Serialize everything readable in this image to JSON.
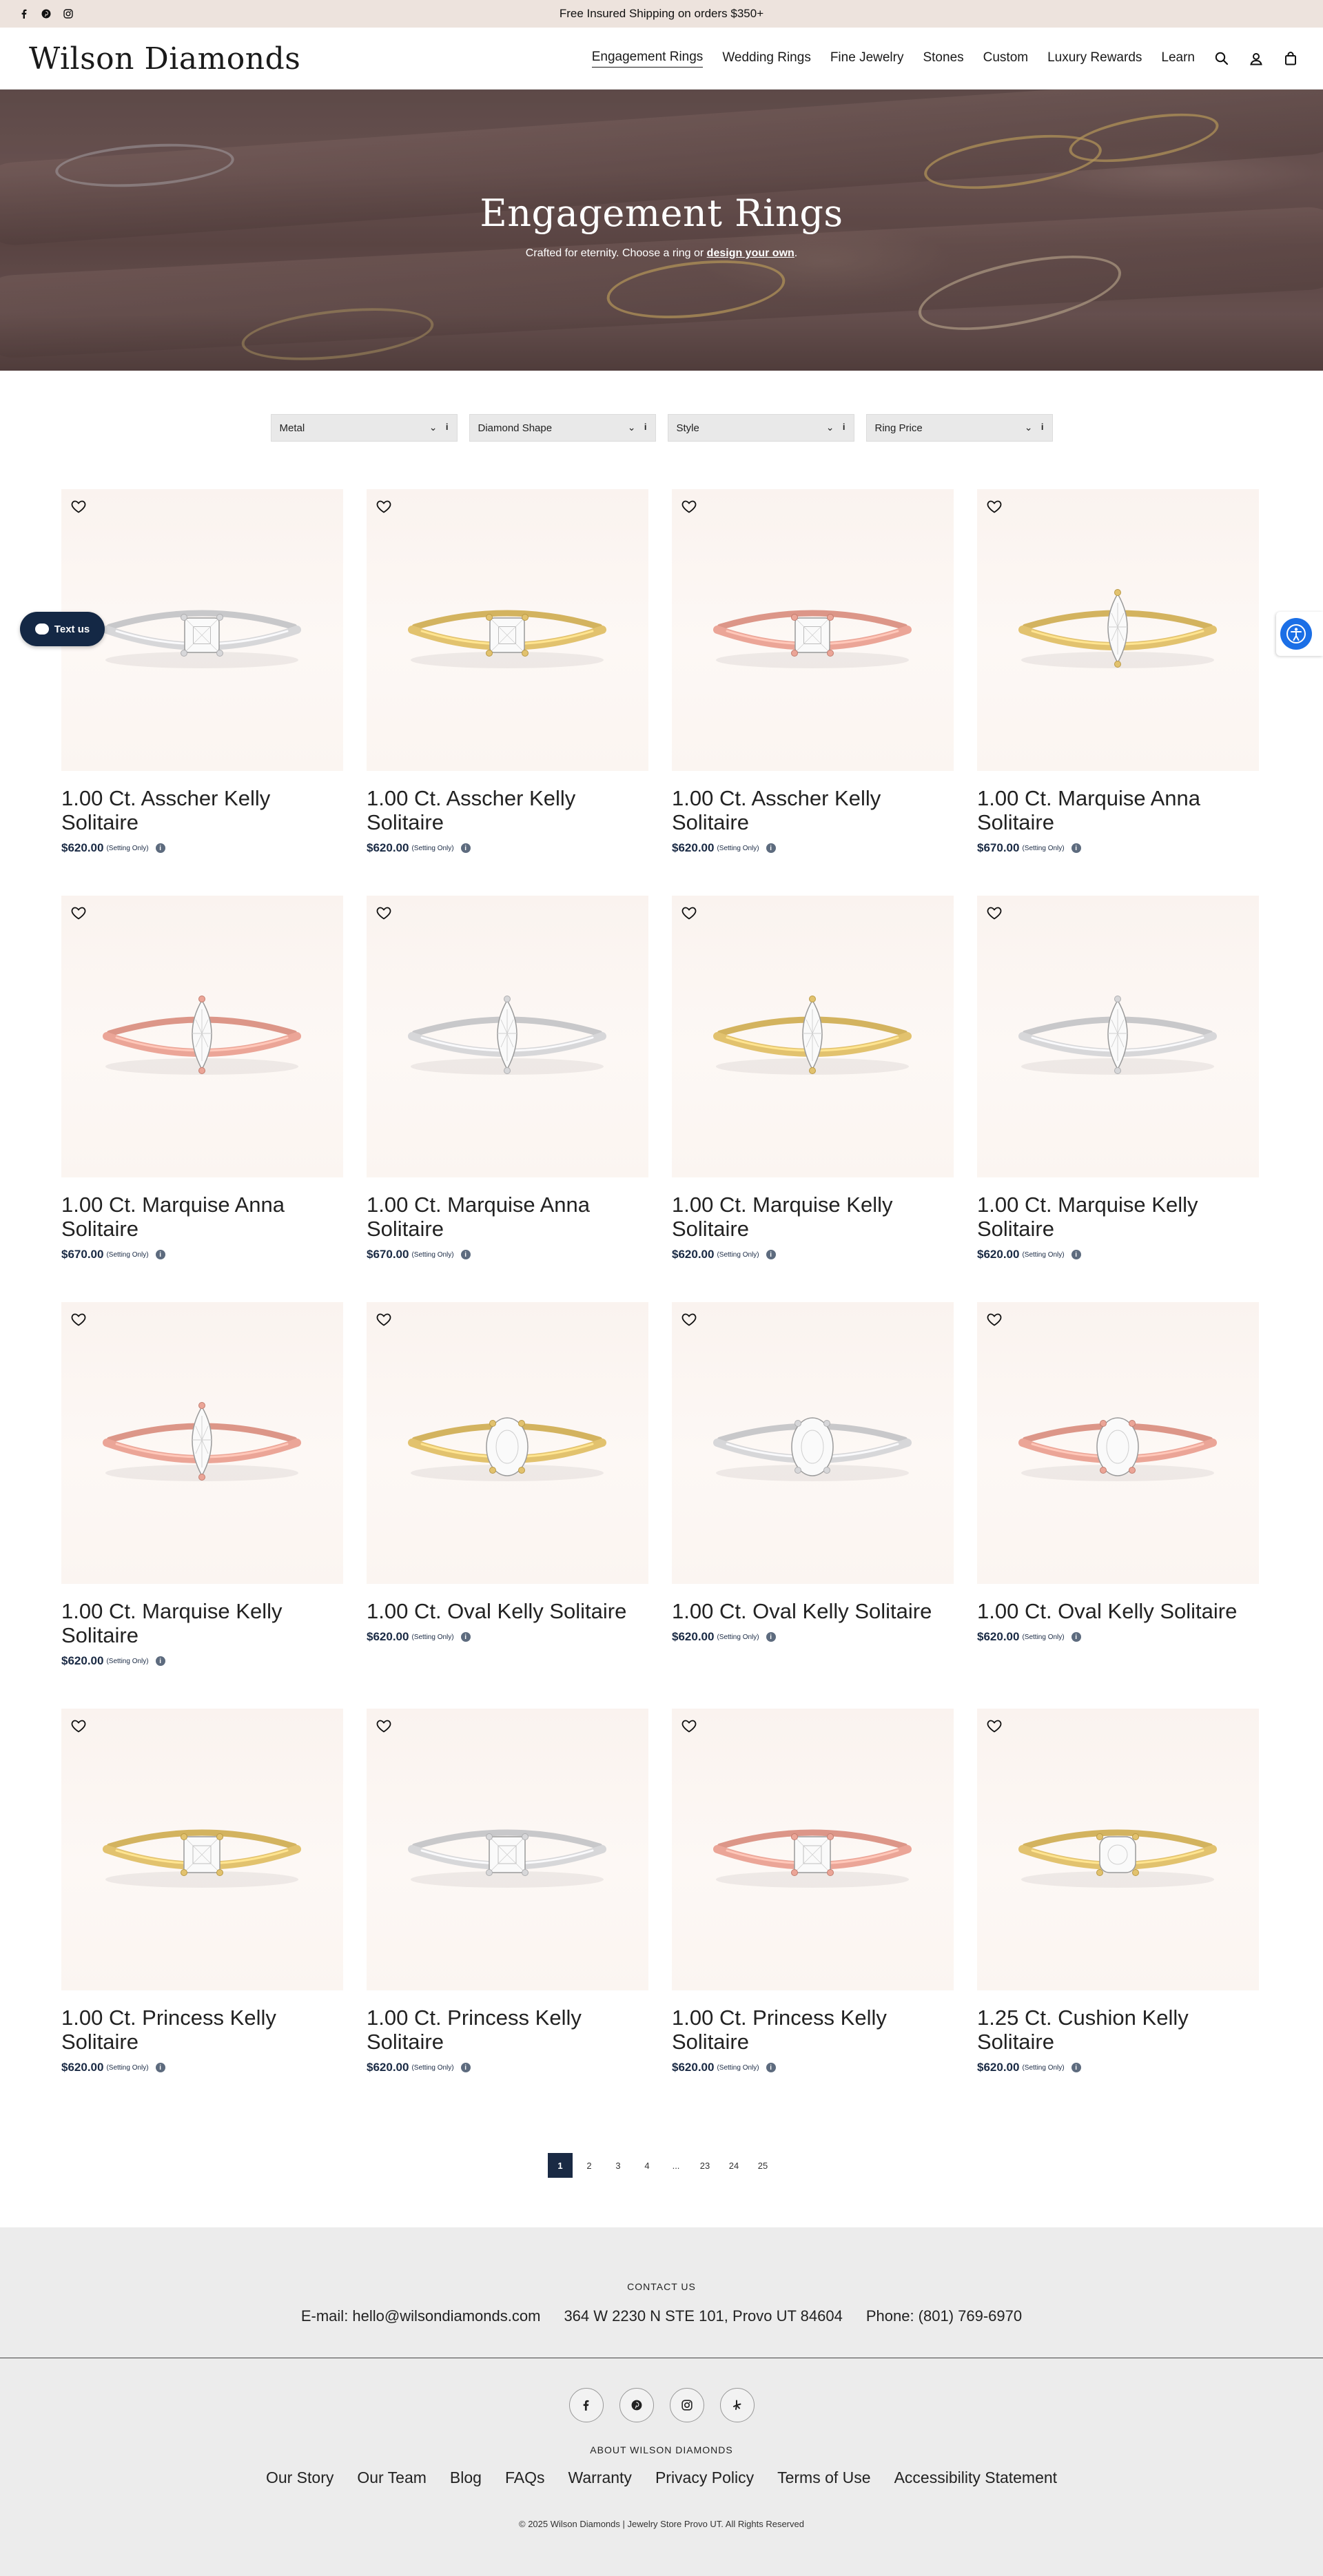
{
  "topbar": {
    "promo": "Free Insured Shipping on orders $350+",
    "social_icons": [
      "facebook-icon",
      "pinterest-icon",
      "instagram-icon"
    ]
  },
  "header": {
    "logo": "Wilson Diamonds",
    "nav": [
      {
        "label": "Engagement Rings",
        "active": true
      },
      {
        "label": "Wedding Rings"
      },
      {
        "label": "Fine Jewelry"
      },
      {
        "label": "Stones"
      },
      {
        "label": "Custom"
      },
      {
        "label": "Luxury Rewards"
      },
      {
        "label": "Learn"
      }
    ],
    "icons": [
      "search-icon",
      "account-icon",
      "cart-icon"
    ]
  },
  "hero": {
    "title": "Engagement Rings",
    "subtitle_prefix": "Crafted for eternity. Choose a ring or ",
    "subtitle_link": "design your own",
    "subtitle_suffix": "."
  },
  "filters": [
    "Metal",
    "Diamond Shape",
    "Style",
    "Ring Price"
  ],
  "products": [
    {
      "title": "1.00 Ct. Asscher Kelly Solitaire",
      "price": "$620.00",
      "note": "(Setting Only)",
      "metal": "white",
      "shape": "asscher"
    },
    {
      "title": "1.00 Ct. Asscher Kelly Solitaire",
      "price": "$620.00",
      "note": "(Setting Only)",
      "metal": "yellow",
      "shape": "asscher"
    },
    {
      "title": "1.00 Ct. Asscher Kelly Solitaire",
      "price": "$620.00",
      "note": "(Setting Only)",
      "metal": "rose",
      "shape": "asscher"
    },
    {
      "title": "1.00 Ct. Marquise Anna Solitaire",
      "price": "$670.00",
      "note": "(Setting Only)",
      "metal": "yellow",
      "shape": "marquise"
    },
    {
      "title": "1.00 Ct. Marquise Anna Solitaire",
      "price": "$670.00",
      "note": "(Setting Only)",
      "metal": "rose",
      "shape": "marquise"
    },
    {
      "title": "1.00 Ct. Marquise Anna Solitaire",
      "price": "$670.00",
      "note": "(Setting Only)",
      "metal": "white",
      "shape": "marquise"
    },
    {
      "title": "1.00 Ct. Marquise Kelly Solitaire",
      "price": "$620.00",
      "note": "(Setting Only)",
      "metal": "yellow",
      "shape": "marquise"
    },
    {
      "title": "1.00 Ct. Marquise Kelly Solitaire",
      "price": "$620.00",
      "note": "(Setting Only)",
      "metal": "white",
      "shape": "marquise"
    },
    {
      "title": "1.00 Ct. Marquise Kelly Solitaire",
      "price": "$620.00",
      "note": "(Setting Only)",
      "metal": "rose",
      "shape": "marquise"
    },
    {
      "title": "1.00 Ct. Oval Kelly Solitaire",
      "price": "$620.00",
      "note": "(Setting Only)",
      "metal": "yellow",
      "shape": "oval"
    },
    {
      "title": "1.00 Ct. Oval Kelly Solitaire",
      "price": "$620.00",
      "note": "(Setting Only)",
      "metal": "white",
      "shape": "oval"
    },
    {
      "title": "1.00 Ct. Oval Kelly Solitaire",
      "price": "$620.00",
      "note": "(Setting Only)",
      "metal": "rose",
      "shape": "oval"
    },
    {
      "title": "1.00 Ct. Princess Kelly Solitaire",
      "price": "$620.00",
      "note": "(Setting Only)",
      "metal": "yellow",
      "shape": "princess"
    },
    {
      "title": "1.00 Ct. Princess Kelly Solitaire",
      "price": "$620.00",
      "note": "(Setting Only)",
      "metal": "white",
      "shape": "princess"
    },
    {
      "title": "1.00 Ct. Princess Kelly Solitaire",
      "price": "$620.00",
      "note": "(Setting Only)",
      "metal": "rose",
      "shape": "princess"
    },
    {
      "title": "1.25 Ct. Cushion Kelly Solitaire",
      "price": "$620.00",
      "note": "(Setting Only)",
      "metal": "yellow",
      "shape": "cushion"
    }
  ],
  "metal_colors": {
    "white": "#d7d7d9",
    "yellow": "#e2c26e",
    "rose": "#eba597"
  },
  "pagination": {
    "pages": [
      "1",
      "2",
      "3",
      "4",
      "...",
      "23",
      "24",
      "25"
    ],
    "current": "1"
  },
  "widgets": {
    "text_us": "Text us"
  },
  "footer": {
    "contact_heading": "CONTACT US",
    "email": "E-mail: hello@wilsondiamonds.com",
    "address": "364 W 2230 N STE 101, Provo UT 84604",
    "phone": "Phone: (801) 769-6970",
    "social_icons": [
      "facebook-icon",
      "pinterest-icon",
      "instagram-icon",
      "yelp-icon"
    ],
    "about_heading": "ABOUT WILSON DIAMONDS",
    "links": [
      "Our Story",
      "Our Team",
      "Blog",
      "FAQs",
      "Warranty",
      "Privacy Policy",
      "Terms of Use",
      "Accessibility Statement"
    ],
    "copyright": "© 2025 Wilson Diamonds | Jewelry Store Provo UT. All Rights Reserved"
  },
  "colors": {
    "accent_navy": "#1a2a44",
    "topbar_bg": "#ede3dd",
    "footer_bg": "#ececec",
    "accessibility_blue": "#1b6fe6"
  }
}
